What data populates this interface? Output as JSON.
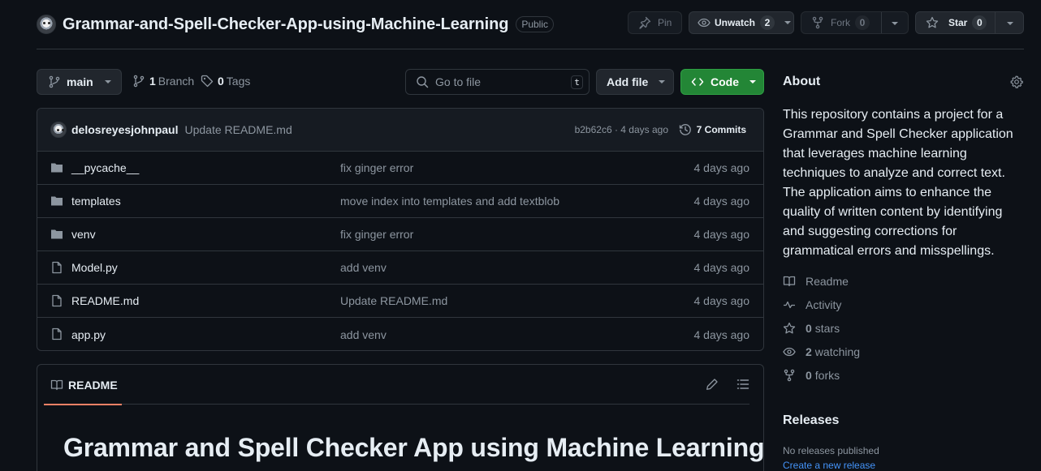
{
  "repo": {
    "name": "Grammar-and-Spell-Checker-App-using-Machine-Learning",
    "visibility": "Public"
  },
  "actions": {
    "pin_label": "Pin",
    "unwatch_label": "Unwatch",
    "watch_count": "2",
    "fork_label": "Fork",
    "fork_count": "0",
    "star_label": "Star",
    "star_count": "0"
  },
  "toolbar": {
    "branch": "main",
    "branch_count": "1",
    "branch_label": "Branch",
    "tag_count": "0",
    "tag_label": "Tags",
    "search_placeholder": "Go to file",
    "search_shortcut": "t",
    "add_file_label": "Add file",
    "code_label": "Code"
  },
  "latest_commit": {
    "author": "delosreyesjohnpaul",
    "message": "Update README.md",
    "hash_age": "b2b62c6 · 4 days ago",
    "commits_label": "7 Commits"
  },
  "files": [
    {
      "type": "folder",
      "name": "__pycache__",
      "message": "fix ginger error",
      "age": "4 days ago"
    },
    {
      "type": "folder",
      "name": "templates",
      "message": "move index into templates and add textblob",
      "age": "4 days ago"
    },
    {
      "type": "folder",
      "name": "venv",
      "message": "fix ginger error",
      "age": "4 days ago"
    },
    {
      "type": "file",
      "name": "Model.py",
      "message": "add venv",
      "age": "4 days ago"
    },
    {
      "type": "file",
      "name": "README.md",
      "message": "Update README.md",
      "age": "4 days ago"
    },
    {
      "type": "file",
      "name": "app.py",
      "message": "add venv",
      "age": "4 days ago"
    }
  ],
  "readme": {
    "tab_label": "README",
    "title": "Grammar and Spell Checker App using Machine Learning"
  },
  "about": {
    "heading": "About",
    "description": "This repository contains a project for a Grammar and Spell Checker application that leverages machine learning techniques to analyze and correct text. The application aims to enhance the quality of written content by identifying and suggesting corrections for grammatical errors and misspellings.",
    "readme_label": "Readme",
    "activity_label": "Activity",
    "stars_count": "0",
    "stars_label": "stars",
    "watching_count": "2",
    "watching_label": "watching",
    "forks_count": "0",
    "forks_label": "forks"
  },
  "releases": {
    "heading": "Releases",
    "none_text": "No releases published",
    "create_link": "Create a new release"
  },
  "colors": {
    "background": "#0d1117",
    "accent_green": "#238636",
    "link_blue": "#4493f8",
    "tab_underline": "#f78166"
  }
}
